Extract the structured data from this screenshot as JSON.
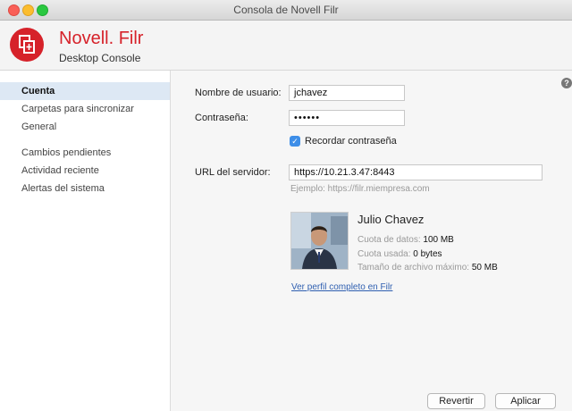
{
  "window": {
    "title": "Consola de Novell Filr"
  },
  "header": {
    "brand_name": "Novell. Filr",
    "brand_sub": "Desktop Console"
  },
  "sidebar": {
    "items": [
      {
        "label": "Cuenta",
        "active": true
      },
      {
        "label": "Carpetas para sincronizar"
      },
      {
        "label": "General"
      },
      {
        "label": "Cambios pendientes"
      },
      {
        "label": "Actividad reciente"
      },
      {
        "label": "Alertas del sistema"
      }
    ]
  },
  "account": {
    "username_label": "Nombre de usuario:",
    "username_value": "jchavez",
    "password_label": "Contraseña:",
    "password_value": "••••••",
    "remember_label": "Recordar contraseña",
    "server_label": "URL del servidor:",
    "server_value": "https://10.21.3.47:8443",
    "server_hint": "Ejemplo: https://filr.miempresa.com"
  },
  "profile": {
    "name": "Julio Chavez",
    "data_quota_label": "Cuota de datos:",
    "data_quota_value": "100 MB",
    "used_quota_label": "Cuota usada:",
    "used_quota_value": "0 bytes",
    "max_file_label": "Tamaño de archivo máximo:",
    "max_file_value": "50 MB",
    "profile_link": "Ver perfil completo en Filr"
  },
  "buttons": {
    "revert": "Revertir",
    "apply": "Aplicar"
  },
  "help": {
    "glyph": "?"
  },
  "colors": {
    "brand_red": "#d6222a",
    "selection": "#dde8f4",
    "checkbox_blue": "#3d8ee8",
    "link": "#2f5fb0"
  }
}
